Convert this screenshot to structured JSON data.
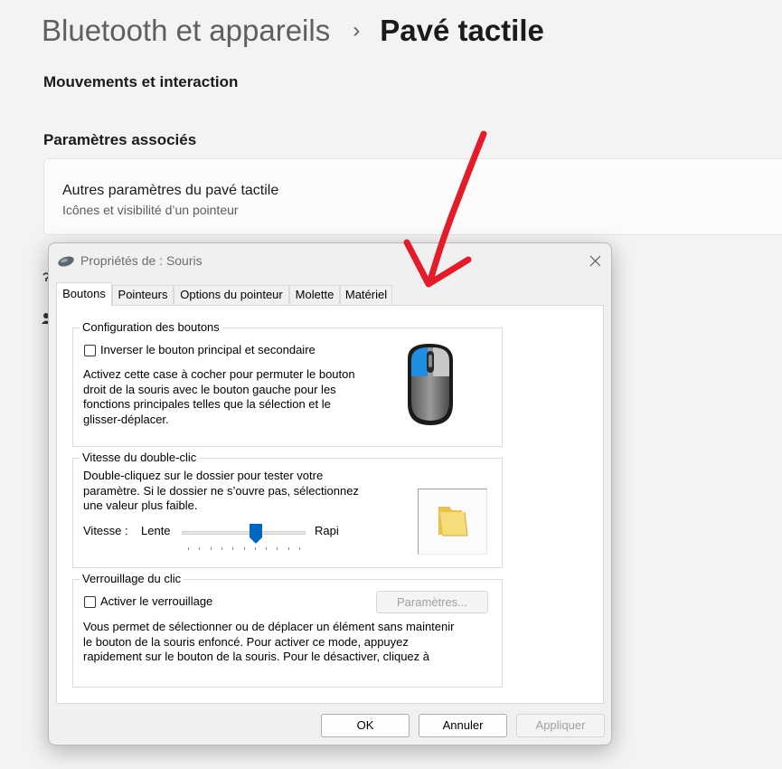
{
  "breadcrumb": {
    "parent": "Bluetooth et appareils",
    "separator": "›",
    "current": "Pavé tactile"
  },
  "sections": {
    "gestures": "Mouvements et interaction",
    "related": "Paramètres associés"
  },
  "related_card": {
    "title": "Autres paramètres du pavé tactile",
    "subtitle": "Icônes et visibilité d’un pointeur"
  },
  "dialog": {
    "title": "Propriétés de : Souris",
    "tabs": [
      "Boutons",
      "Pointeurs",
      "Options du pointeur",
      "Molette",
      "Matériel"
    ],
    "active_tab": "Boutons",
    "button_config": {
      "title": "Configuration des boutons",
      "checkbox_label": "Inverser le bouton principal et secondaire",
      "checked": false,
      "description": [
        "Activez cette case à cocher pour permuter le bouton",
        "droit de la souris avec le bouton gauche pour les",
        "fonctions principales telles que la sélection et le",
        "glisser-déplacer."
      ]
    },
    "double_click": {
      "title": "Vitesse du double-clic",
      "description": [
        "Double-cliquez sur le dossier pour tester votre",
        "paramètre. Si le dossier ne s’ouvre pas, sélectionnez",
        "une valeur plus faible."
      ],
      "speed_label": "Vitesse :",
      "slow_label": "Lente",
      "fast_label": "Rapi",
      "slider_fraction": 0.6
    },
    "click_lock": {
      "title": "Verrouillage du clic",
      "checkbox_label": "Activer le verrouillage",
      "checked": false,
      "settings_button": "Paramètres...",
      "description": [
        "Vous permet de sélectionner ou de déplacer un élément sans maintenir",
        "le bouton de la souris enfoncé. Pour activer ce mode, appuyez",
        "rapidement sur le bouton de la souris. Pour le désactiver, cliquez à"
      ]
    },
    "buttons": {
      "ok": "OK",
      "cancel": "Annuler",
      "apply": "Appliquer"
    }
  },
  "colors": {
    "arrow": "#e31b2b",
    "mouse_highlight": "#1e8fe3",
    "slider_thumb": "#0067c0"
  },
  "icons": {
    "close": "close-icon",
    "mouse_small": "mouse-icon",
    "mouse_large": "mouse-illustration",
    "folder": "folder-icon"
  }
}
